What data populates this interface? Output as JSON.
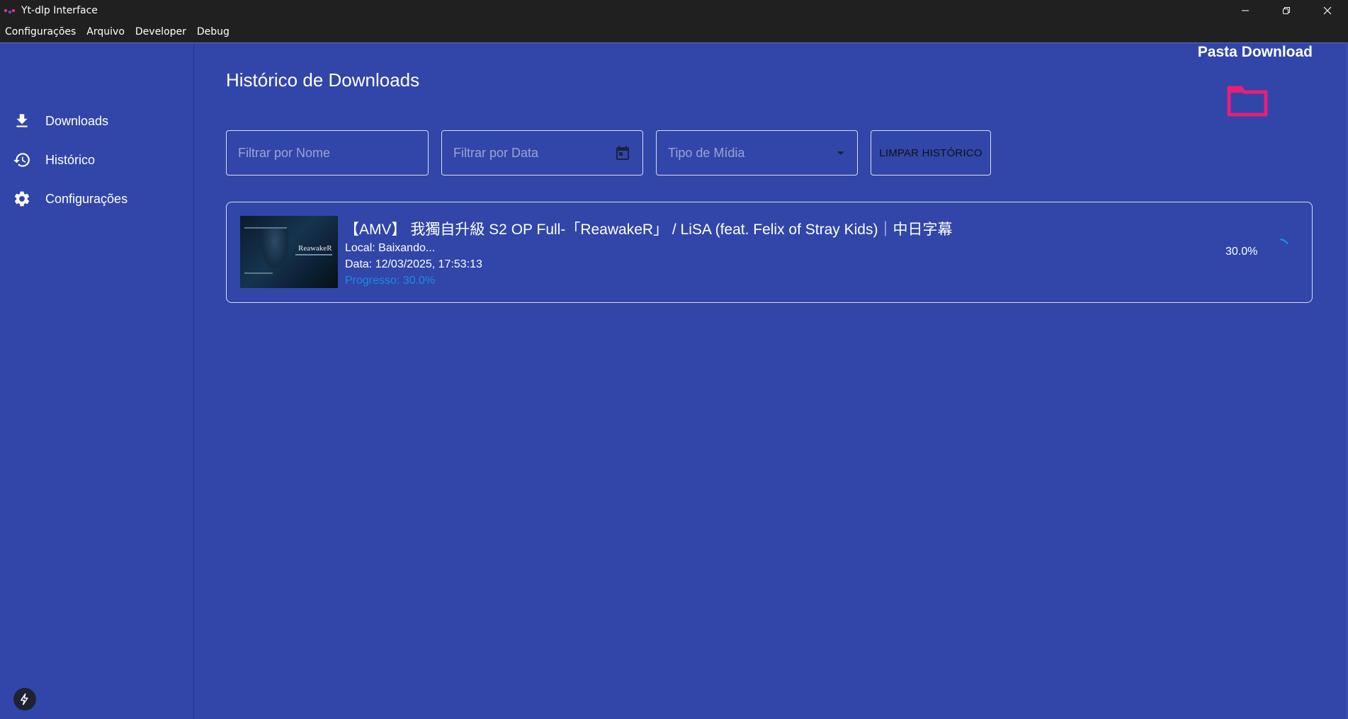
{
  "window": {
    "title": "Yt-dlp Interface",
    "controls": [
      "minimize-icon",
      "restore-icon",
      "close-icon"
    ]
  },
  "menubar": {
    "items": [
      "Configurações",
      "Arquivo",
      "Developer",
      "Debug"
    ]
  },
  "sidebar": {
    "items": [
      {
        "label": "Downloads",
        "icon": "download-icon"
      },
      {
        "label": "Histórico",
        "icon": "history-icon"
      },
      {
        "label": "Configurações",
        "icon": "gear-icon"
      }
    ],
    "footer_icon": "bolt-icon"
  },
  "main": {
    "title": "Histórico de Downloads",
    "folder_label": "Pasta Download",
    "folder_icon": "folder-icon",
    "filters": {
      "name_placeholder": "Filtrar por Nome",
      "date_placeholder": "Filtrar por Data",
      "type_placeholder": "Tipo de Mídia",
      "clear_label": "LIMPAR HISTÓRICO"
    },
    "history": [
      {
        "title": "【AMV】 我獨自升級 S2 OP Full-「ReawakeR」 / LiSA (feat. Felix of Stray Kids)｜中日字幕",
        "local": "Local: Baixando...",
        "date": "Data: 12/03/2025, 17:53:13",
        "progress_text": "Progresso: 30.0%",
        "progress_pct": "30.0%",
        "progress_value": 30.0,
        "thumbnail_text": "ReawakeR"
      }
    ]
  },
  "colors": {
    "background": "#3146a8",
    "titlebar": "#202020",
    "accent_pink": "#e91e78",
    "progress_blue": "#1e88e5"
  }
}
